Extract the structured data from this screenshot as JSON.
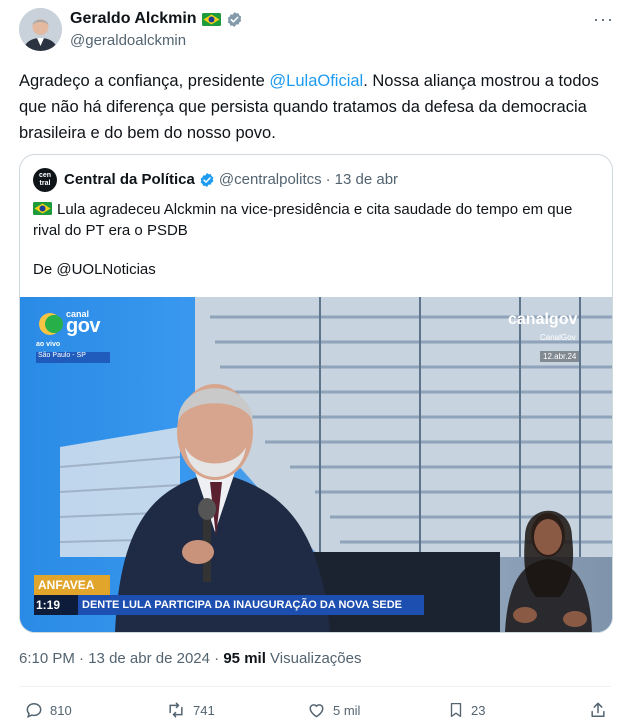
{
  "author": {
    "name": "Geraldo Alckmin",
    "handle": "@geraldoalckmin",
    "flag_icon": "brazil-flag-icon",
    "verified_icon": "verified-badge-icon"
  },
  "more_label": "···",
  "tweet": {
    "text_before": "Agradeço a confiança, presidente ",
    "mention": "@LulaOficial",
    "text_after": ". Nossa aliança mostrou a todos que não há diferença que persista quando tratamos da defesa da democracia brasileira e do bem do nosso povo."
  },
  "quote": {
    "avatar_text": "cen tral",
    "name": "Central da Política",
    "handle": "@centralpolitcs",
    "separator": "·",
    "date": "13 de abr",
    "text": "Lula agradeceu Alckmin na vice-presidência e cita saudade do tempo em que rival do PT era o PSDB",
    "from": "De @UOLNoticias",
    "video": {
      "logo_top": "canal",
      "logo_main": "gov",
      "live": "ao vivo",
      "location": "São Paulo - SP",
      "corner_logo": "canal",
      "corner_logo_b": "gov",
      "corner_sub": "CanalGov",
      "corner_date": "12.abr.24",
      "tag": "ANFAVEA",
      "duration": "1:19",
      "ticker": "DENTE LULA PARTICIPA DA INAUGURAÇÃO DA NOVA SEDE"
    }
  },
  "meta": {
    "time": "6:10 PM",
    "sep": "·",
    "date": "13 de abr de 2024",
    "sep2": "·",
    "views_count": "95 mil",
    "views_label": "Visualizações"
  },
  "actions": {
    "replies": "810",
    "retweets": "741",
    "likes": "5 mil",
    "bookmarks": "23"
  },
  "colors": {
    "accent": "#1d9bf0",
    "text": "#0f1419",
    "muted": "#536471",
    "border": "#cfd9de"
  }
}
